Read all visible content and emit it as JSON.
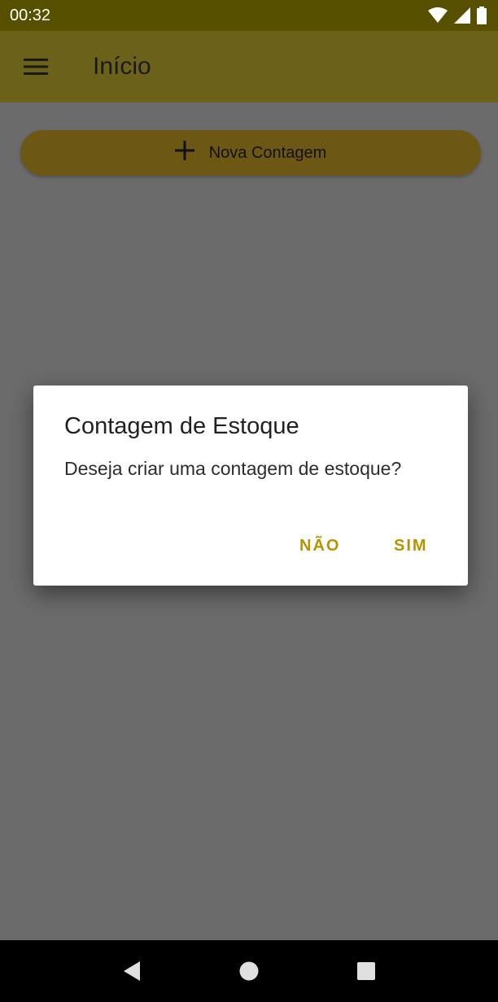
{
  "status_bar": {
    "time": "00:32",
    "icons": [
      "wifi-icon",
      "signal-icon",
      "battery-icon"
    ]
  },
  "app_bar": {
    "title": "Início",
    "menu_icon": "menu-icon",
    "color": "#6c6119"
  },
  "main": {
    "new_count_button": {
      "label": "Nova Contagem",
      "icon": "plus-icon",
      "color": "#6c5814"
    }
  },
  "dialog": {
    "title": "Contagem de Estoque",
    "message": "Deseja criar uma contagem de estoque?",
    "negative_label": "NÃO",
    "positive_label": "SIM",
    "accent_color": "#b89300"
  },
  "nav_bar": {
    "buttons": [
      "back-icon",
      "home-icon",
      "recents-icon"
    ]
  }
}
